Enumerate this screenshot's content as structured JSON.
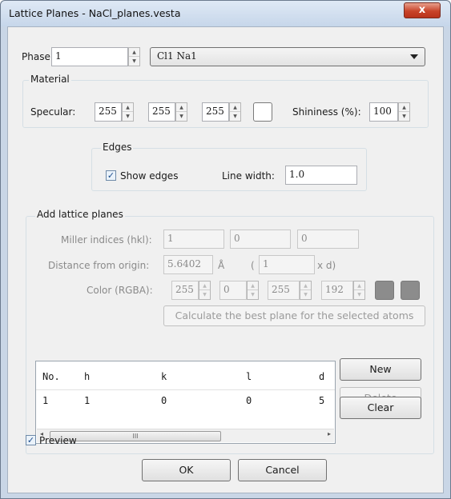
{
  "window": {
    "title": "Lattice Planes - NaCl_planes.vesta",
    "close_glyph": "x"
  },
  "phase": {
    "label": "Phase:",
    "value": "1",
    "selected": "Cl1 Na1"
  },
  "material": {
    "group_label": "Material",
    "specular_label": "Specular:",
    "specular_values": [
      "255",
      "255",
      "255"
    ],
    "shininess_label": "Shininess (%):",
    "shininess_value": "100",
    "swatch_color": "#ffffff"
  },
  "edges": {
    "group_label": "Edges",
    "show_edges_label": "Show edges",
    "show_edges_checked": true,
    "line_width_label": "Line width:",
    "line_width_value": "1.0"
  },
  "add_planes": {
    "group_label": "Add lattice planes",
    "miller_label": "Miller indices (hkl):",
    "miller_values": [
      "1",
      "0",
      "0"
    ],
    "distance_label": "Distance from origin:",
    "distance_value": "5.6402",
    "distance_unit": "Å",
    "paren_open": "(",
    "d_multiple": "1",
    "d_suffix": "x d)",
    "color_label": "Color (RGBA):",
    "color_values": [
      "255",
      "0",
      "255",
      "192"
    ],
    "calc_button": "Calculate the best plane for the selected atoms"
  },
  "table": {
    "columns": [
      "No.",
      "h",
      "k",
      "l",
      "d"
    ],
    "rows": [
      {
        "no": "1",
        "h": "1",
        "k": "0",
        "l": "0",
        "d": "5"
      }
    ],
    "scroll_left": "◂",
    "scroll_right": "▸",
    "thumb_grip": "III"
  },
  "buttons": {
    "new": "New",
    "delete": "Delete",
    "clear": "Clear",
    "ok": "OK",
    "cancel": "Cancel"
  },
  "preview": {
    "label": "Preview",
    "checked": true
  },
  "colors": {
    "title_bg": "#c6d6ea",
    "client_bg": "#f0f0f0",
    "swatch_grey": "#8c8c8c"
  }
}
